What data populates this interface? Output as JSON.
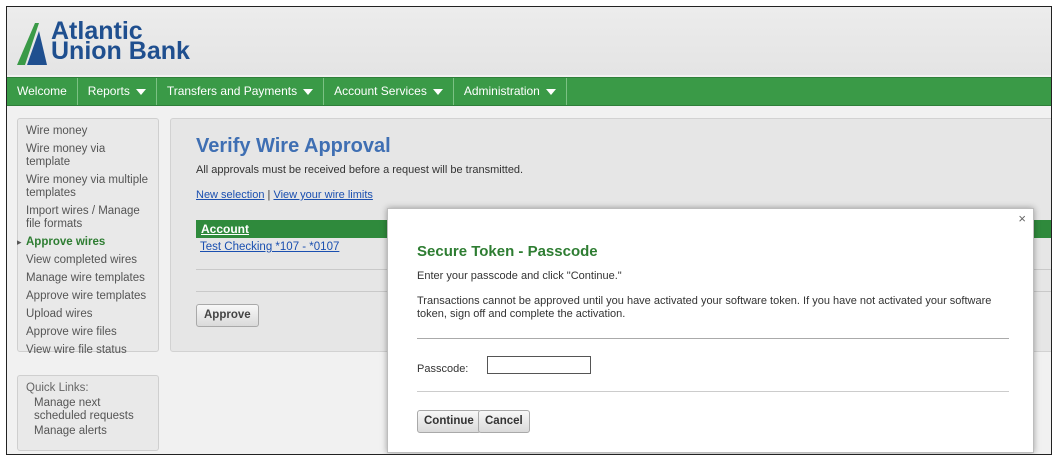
{
  "brand": {
    "line1": "Atlantic",
    "line2": "Union Bank",
    "color": "#1f4f8f"
  },
  "nav": [
    {
      "label": "Welcome",
      "has_caret": false
    },
    {
      "label": "Reports",
      "has_caret": true
    },
    {
      "label": "Transfers and Payments",
      "has_caret": true
    },
    {
      "label": "Account Services",
      "has_caret": true
    },
    {
      "label": "Administration",
      "has_caret": true
    }
  ],
  "sidebar": {
    "items": [
      "Wire money",
      "Wire money via template",
      "Wire money via multiple templates",
      "Import wires / Manage file formats",
      "Approve wires",
      "View completed wires",
      "Manage wire templates",
      "Approve wire templates",
      "Upload wires",
      "Approve wire files",
      "View wire file status"
    ],
    "active_index": 4
  },
  "quick_links": {
    "title": "Quick Links:",
    "items": [
      "Manage next scheduled requests",
      "Manage alerts"
    ]
  },
  "main": {
    "title": "Verify Wire Approval",
    "subtitle": "All approvals must be received before a request will be transmitted.",
    "link_new": "New selection",
    "link_sep": " | ",
    "link_limits": "View your wire limits",
    "table_header": "Account",
    "row_account": "Test Checking *107 - *0107",
    "approve_label": "Approve"
  },
  "modal": {
    "close": "×",
    "title": "Secure Token - Passcode",
    "instruction": "Enter your passcode and click \"Continue.\"",
    "warning": "Transactions cannot be approved until you have activated your software token. If you have not activated your software token, sign off and complete the activation.",
    "passcode_label": "Passcode:",
    "passcode_value": "",
    "continue_label": "Continue",
    "cancel_label": "Cancel"
  },
  "colors": {
    "nav_green": "#3a9a47",
    "title_blue": "#3f6fb3",
    "modal_title_green": "#2e7d32",
    "link_blue": "#1a4fb0"
  }
}
